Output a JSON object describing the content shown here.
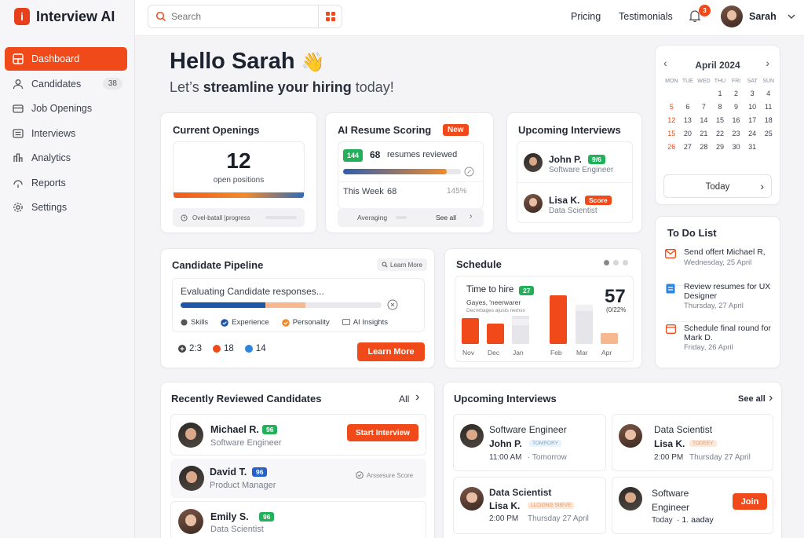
{
  "app": {
    "name": "Interview AI",
    "logo_letter": "i"
  },
  "nav": [
    {
      "label": "Dashboard",
      "icon": "dashboard-icon",
      "active": true
    },
    {
      "label": "Candidates",
      "icon": "user-icon",
      "count": "38"
    },
    {
      "label": "Job Openings",
      "icon": "briefcase-icon"
    },
    {
      "label": "Interviews",
      "icon": "list-icon"
    },
    {
      "label": "Analytics",
      "icon": "chart-icon"
    },
    {
      "label": "Reports",
      "icon": "reports-icon"
    },
    {
      "label": "Settings",
      "icon": "gear-icon"
    }
  ],
  "topbar": {
    "search_placeholder": "Search",
    "pricing": "Pricing",
    "testimonials": "Testimonials",
    "notifications": "3",
    "user": "Sarah"
  },
  "greeting": {
    "hello": "Hello Sarah",
    "emoji": "👋",
    "sub_pre": "Let’s ",
    "sub_bold": "streamline your hiring",
    "sub_post": " today!"
  },
  "openings": {
    "title": "Current Openings",
    "count": "12",
    "label": "open positions",
    "footer": "Ovel-batall |progress"
  },
  "resume": {
    "title": "AI Resume Scoring",
    "badge": "New",
    "count_badge": "144",
    "count": "68",
    "count_label": "resumes reviewed",
    "progress": 0.88,
    "week_label": "This Week",
    "week_value": "68",
    "pct": "145%",
    "averaging": "Averaging",
    "see_all": "See all"
  },
  "upcoming_small": {
    "title": "Upcoming Interviews",
    "items": [
      {
        "name": "John P.",
        "badge": "9/6",
        "role": "Software Engineer"
      },
      {
        "name": "Lisa K.",
        "badge": "Score",
        "role": "Data Scientist"
      }
    ]
  },
  "calendar": {
    "month": "April 2024",
    "days": [
      "MON",
      "TUE",
      "WED",
      "THU",
      "FRI",
      "SAT",
      "SUN"
    ],
    "today": "Today",
    "cells": [
      [
        "",
        "",
        "",
        "",
        "",
        "",
        ""
      ],
      [
        "",
        "",
        "",
        "1",
        "2",
        "3",
        "4"
      ],
      [
        "5",
        "6",
        "7",
        "8",
        "9",
        "10",
        "11"
      ],
      [
        "12",
        "13",
        "14",
        "15",
        "16",
        "17",
        "18"
      ],
      [
        "15",
        "20",
        "21",
        "22",
        "23",
        "24",
        "25"
      ],
      [
        "26",
        "27",
        "28",
        "29",
        "30",
        "31",
        ""
      ]
    ]
  },
  "pipeline": {
    "title": "Candidate Pipeline",
    "learn_chip": "Learn More",
    "status": "Evaluating Candidate responses...",
    "legend": [
      "Skills",
      "Experience",
      "Personality",
      "AI Insights"
    ],
    "stats": [
      "2:3",
      "18",
      "14"
    ],
    "button": "Learn More",
    "progress_blue": 0.42,
    "progress_peach": 0.2
  },
  "schedule": {
    "title": "Schedule",
    "label": "Time to hire",
    "badge": "27",
    "l2": "Gayes, 'neerwarer",
    "l3": "Decrebages ajusts nemss",
    "big": "57",
    "big_sub": "(0/22%",
    "months": [
      "Nov",
      "Dec",
      "Jan",
      "Feb",
      "Mar",
      "Apr"
    ],
    "values": [
      0.28,
      0.22,
      0.3,
      0.52,
      0.42,
      0.12
    ]
  },
  "todo": {
    "title": "To Do List",
    "items": [
      {
        "text": "Send offert Michael R,",
        "date": "Wednesday, 25 April",
        "icon": "mail-icon"
      },
      {
        "text": "Review resumes for UX Designer",
        "date": "Thursday, 27 April",
        "icon": "clipboard-icon"
      },
      {
        "text": "Schedule final round for Mark D.",
        "date": "Friday, 26 April",
        "icon": "calendar-icon"
      }
    ]
  },
  "reviewed": {
    "title": "Recently Reviewed Candidates",
    "all": "All",
    "items": [
      {
        "name": "Michael R.",
        "badge": "96",
        "role": "Software Engineer",
        "action": "Start Interview"
      },
      {
        "name": "David T.",
        "badge": "96",
        "role": "Product Manager",
        "action": "Arssesure Score"
      },
      {
        "name": "Emily S.",
        "badge": "96",
        "role": "Data Scientist"
      }
    ]
  },
  "upcoming_big": {
    "title": "Upcoming Interviews",
    "see_all": "See all",
    "items": [
      {
        "role": "Software Engineer",
        "name": "John P.",
        "tag": "TOMRORY",
        "time": "11:00 AM",
        "when": "· Tomorrow"
      },
      {
        "role": "Data Scientist",
        "name": "Lisa K.",
        "tag": "TODEEY",
        "time": "2:00 PM",
        "when": "Thursday 27 April"
      },
      {
        "role": "Data Scientist",
        "name": "Lisa K.",
        "tag": "LLCIONG SIIEVE",
        "time": "2:00 PM",
        "when": "Thursday 27 April"
      },
      {
        "role": "Software Engineer",
        "name": "",
        "tag": "",
        "time": "Today",
        "when": "· 1. aaday",
        "button": "Join"
      }
    ]
  }
}
